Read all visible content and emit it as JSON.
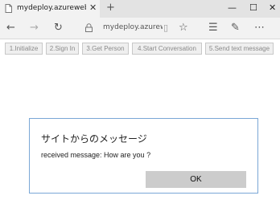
{
  "tab": {
    "title": "mydeploy.azurewebsites",
    "close": "✕"
  },
  "toolbar": {
    "new_tab": "+",
    "minimize": "—",
    "maximize": "☐",
    "close": "✕"
  },
  "nav": {
    "back": "←",
    "forward": "→",
    "refresh": "↻",
    "url": "mydeploy.azurew",
    "reading": "▯",
    "favorite": "☆",
    "hub": "☰",
    "notes": "✎",
    "more": "⋯"
  },
  "page": {
    "buttons": [
      "1.Initialize",
      "2.Sign In",
      "3.Get Person",
      "4.Start Conversation",
      "5.Send text message"
    ]
  },
  "dialog": {
    "title": "サイトからのメッセージ",
    "message": "received message: How are you ?",
    "ok_label": "OK"
  },
  "colors": {
    "dialog_border": "#7aa7d6",
    "ok_bg": "#cccccc"
  }
}
